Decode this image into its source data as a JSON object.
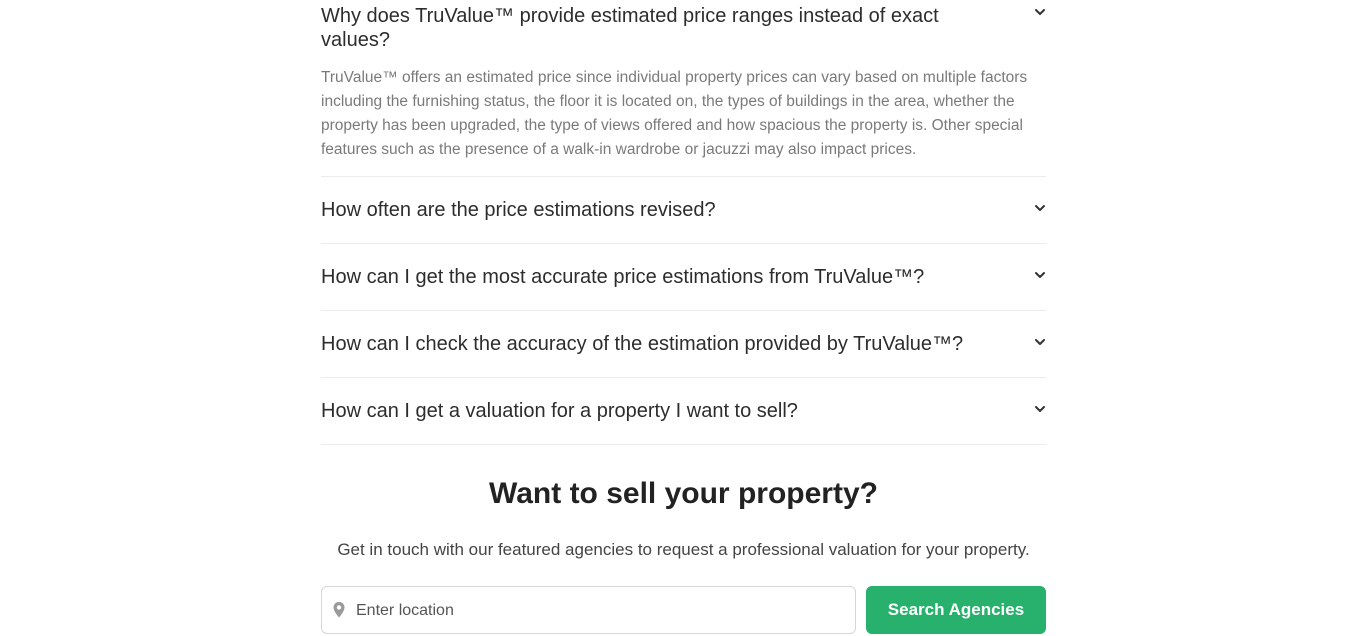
{
  "faq": {
    "items": [
      {
        "question": "Why does TruValue™ provide estimated price ranges instead of exact values?",
        "answer": "TruValue™ offers an estimated price since individual property prices can vary based on multiple factors including the furnishing status, the floor it is located on, the types of buildings in the area, whether the property has been upgraded, the type of views offered and how spacious the property is. Other special features such as the presence of a walk-in wardrobe or jacuzzi may also impact prices.",
        "expanded": true
      },
      {
        "question": "How often are the price estimations revised?",
        "expanded": false
      },
      {
        "question": "How can I get the most accurate price estimations from TruValue™?",
        "expanded": false
      },
      {
        "question": "How can I check the accuracy of the estimation provided by TruValue™?",
        "expanded": false
      },
      {
        "question": "How can I get a valuation for a property I want to sell?",
        "expanded": false
      }
    ],
    "toggle_icon": "chevron-down-icon"
  },
  "sell": {
    "title": "Want to sell your property?",
    "subtitle": "Get in touch with our featured agencies to request a professional valuation for your property.",
    "search_placeholder": "Enter location",
    "search_icon": "location-pin-icon",
    "button_label": "Search Agencies",
    "button_color": "#28b16d"
  }
}
